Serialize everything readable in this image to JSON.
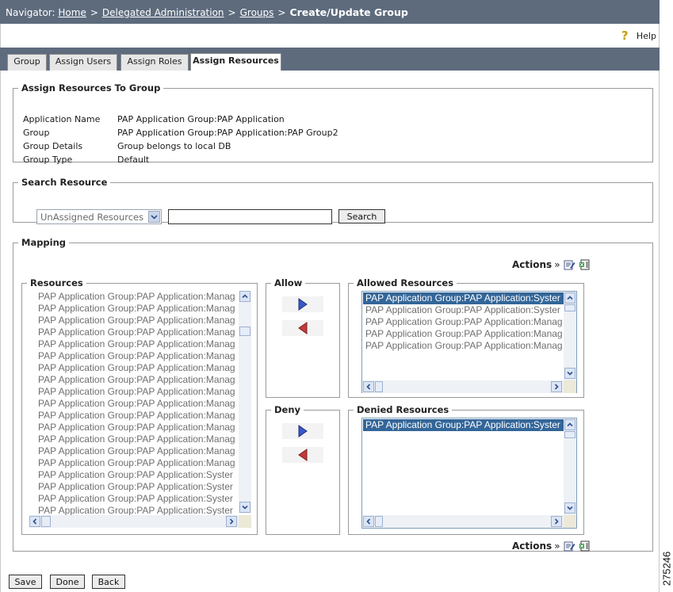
{
  "nav": {
    "label": "Navigator:",
    "crumbs": [
      "Home",
      "Delegated Administration",
      "Groups"
    ],
    "separator": ">",
    "current": "Create/Update Group"
  },
  "help": {
    "label": "Help",
    "icon": "question-icon"
  },
  "tabs": [
    {
      "label": "Group",
      "active": false
    },
    {
      "label": "Assign Users",
      "active": false
    },
    {
      "label": "Assign Roles",
      "active": false
    },
    {
      "label": "Assign Resources",
      "active": true
    }
  ],
  "assign": {
    "legend": "Assign Resources To Group",
    "fields": [
      {
        "label": "Application Name",
        "value": "PAP Application Group:PAP Application"
      },
      {
        "label": "Group",
        "value": "PAP Application Group:PAP Application:PAP Group2"
      },
      {
        "label": "Group Details",
        "value": "Group belongs to local DB"
      },
      {
        "label": "Group Type",
        "value": "Default"
      }
    ]
  },
  "search": {
    "legend": "Search Resource",
    "filter_value": "UnAssigned Resources",
    "input_value": "",
    "button": "Search"
  },
  "mapping": {
    "legend": "Mapping",
    "actions_label": "Actions",
    "actions_sep": "»",
    "resources": {
      "legend": "Resources",
      "items": [
        "PAP Application Group:PAP Application:Manag",
        "PAP Application Group:PAP Application:Manag",
        "PAP Application Group:PAP Application:Manag",
        "PAP Application Group:PAP Application:Manag",
        "PAP Application Group:PAP Application:Manag",
        "PAP Application Group:PAP Application:Manag",
        "PAP Application Group:PAP Application:Manag",
        "PAP Application Group:PAP Application:Manag",
        "PAP Application Group:PAP Application:Manag",
        "PAP Application Group:PAP Application:Manag",
        "PAP Application Group:PAP Application:Manag",
        "PAP Application Group:PAP Application:Manag",
        "PAP Application Group:PAP Application:Manag",
        "PAP Application Group:PAP Application:Manag",
        "PAP Application Group:PAP Application:Manag",
        "PAP Application Group:PAP Application:Syster",
        "PAP Application Group:PAP Application:Syster",
        "PAP Application Group:PAP Application:Syster",
        "PAP Application Group:PAP Application:Syster"
      ]
    },
    "allow": {
      "legend": "Allow"
    },
    "deny": {
      "legend": "Deny"
    },
    "allowed": {
      "legend": "Allowed Resources",
      "items": [
        "PAP Application Group:PAP Application:Syster",
        "PAP Application Group:PAP Application:Syster",
        "PAP Application Group:PAP Application:Manag",
        "PAP Application Group:PAP Application:Manag",
        "PAP Application Group:PAP Application:Manag"
      ]
    },
    "denied": {
      "legend": "Denied Resources",
      "items": [
        "PAP Application Group:PAP Application:Syster"
      ]
    }
  },
  "buttons": {
    "save": "Save",
    "done": "Done",
    "back": "Back"
  },
  "figure_id": "275246",
  "colors": {
    "header": "#5d6b7d",
    "selection": "#336699",
    "allow_arrow": "#3a58c8",
    "remove_arrow": "#c43a3a"
  }
}
